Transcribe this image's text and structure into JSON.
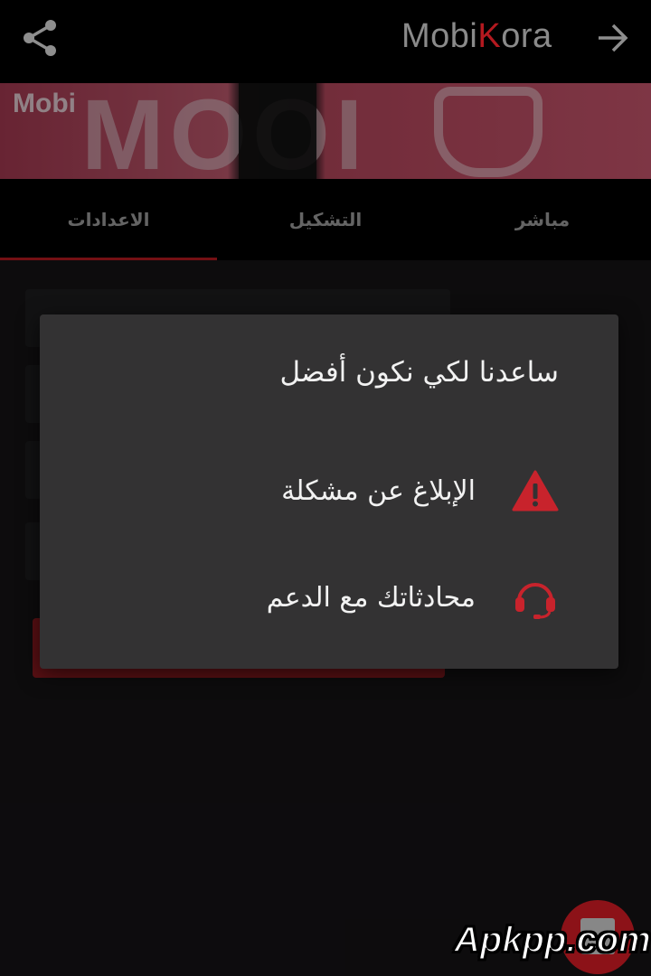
{
  "app_bar": {
    "brand_prefix": "Mobi",
    "brand_highlight": "K",
    "brand_suffix": "ora",
    "share_icon": "share-icon",
    "back_icon": "arrow-right-icon"
  },
  "banner": {
    "logo_text": "Mobi"
  },
  "tabs": [
    {
      "label": "مباشر",
      "active": false
    },
    {
      "label": "التشكيل",
      "active": false
    },
    {
      "label": "الاعدادات",
      "active": true
    }
  ],
  "dialog": {
    "title": "ساعدنا لكي نكون أفضل",
    "options": [
      {
        "label": "الإبلاغ عن مشكلة",
        "icon": "warning-icon"
      },
      {
        "label": "محادثاتك مع الدعم",
        "icon": "headset-icon"
      }
    ]
  },
  "colors": {
    "accent": "#b3191f",
    "dialog_bg": "#333233",
    "app_bar_bg": "#000000"
  },
  "watermark": "Apkpp.com"
}
